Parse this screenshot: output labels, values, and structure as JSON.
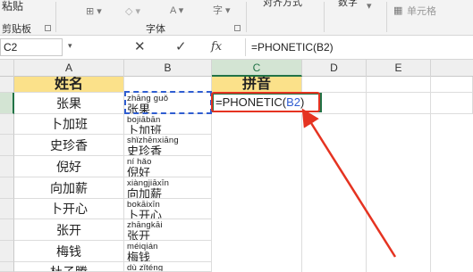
{
  "ribbon": {
    "paste_label": "粘贴",
    "clipboard_label": "剪贴板",
    "font_label": "字体",
    "alignment_label": "对齐方式",
    "number_label": "数字",
    "cell_styles_label": "单元格"
  },
  "formula_bar": {
    "name_box": "C2",
    "cancel_glyph": "✕",
    "enter_glyph": "✓",
    "fx_glyph": "fx",
    "formula": "=PHONETIC(B2)"
  },
  "columns": [
    "A",
    "B",
    "C",
    "D",
    "E"
  ],
  "header_row": {
    "name": "姓名",
    "pinyin": "拼音"
  },
  "rows": [
    {
      "name": "张果",
      "py": "zhāng guǒ",
      "hz": "张果"
    },
    {
      "name": "卜加班",
      "py": "bojiābān",
      "hz": "卜加班"
    },
    {
      "name": "史珍香",
      "py": "shǐzhēnxiāng",
      "hz": "史珍香"
    },
    {
      "name": "倪好",
      "py": "ní hǎo",
      "hz": "倪好"
    },
    {
      "name": "向加薪",
      "py": "xiàngjiāxīn",
      "hz": "向加薪"
    },
    {
      "name": "卜开心",
      "py": "bokāixīn",
      "hz": "卜开心"
    },
    {
      "name": "张开",
      "py": "zhāngkāi",
      "hz": "张开"
    },
    {
      "name": "梅钱",
      "py": "méiqián",
      "hz": "梅钱"
    },
    {
      "name": "杜子腾",
      "py": "dù zǐténg",
      "hz": "杜子腾"
    }
  ],
  "active_cell": {
    "formula_display": "=PHONETIC(",
    "ref": "B2",
    "close": ")"
  },
  "colors": {
    "accent": "#217346",
    "highlight": "#fbe18a",
    "annotation": "#e53321",
    "reference": "#2f5dd1"
  }
}
